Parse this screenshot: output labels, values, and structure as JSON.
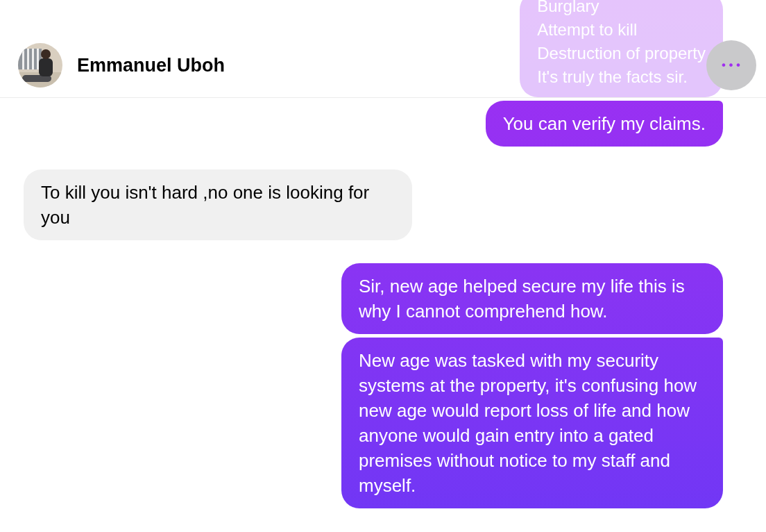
{
  "header": {
    "name": "Emmanuel Uboh"
  },
  "more_button": {
    "label": "•••"
  },
  "messages": [
    {
      "kind": "outgoing",
      "faded": true,
      "text": "Burglary\nAttempt to kill\nDestruction of property\nIt's truly the facts sir."
    },
    {
      "kind": "outgoing",
      "faded": false,
      "text": "You can verify my claims."
    },
    {
      "kind": "incoming",
      "faded": false,
      "text": "To kill you isn't hard ,no one is looking for you"
    },
    {
      "kind": "outgoing",
      "faded": false,
      "text": "Sir, new age helped secure my life this is why I cannot comprehend how."
    },
    {
      "kind": "outgoing",
      "faded": false,
      "text": "New age was tasked with my security systems at the property, it's confusing how new age would report loss of life and how anyone would gain entry into a gated premises without notice to my staff and myself."
    }
  ]
}
